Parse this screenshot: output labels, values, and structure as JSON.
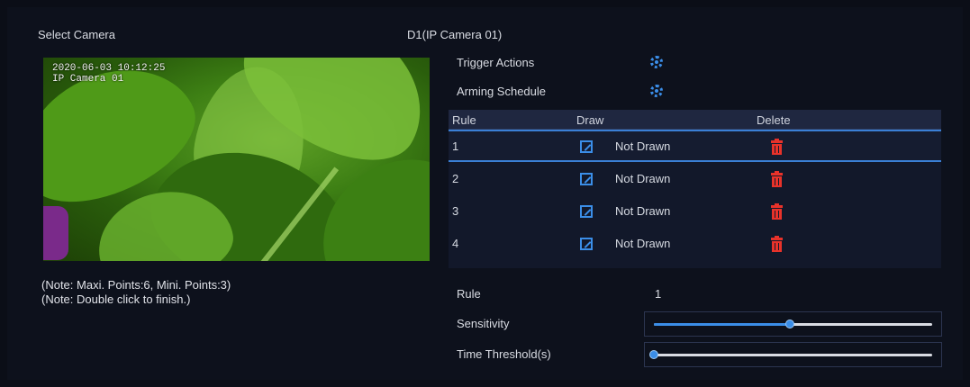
{
  "select_camera_label": "Select Camera",
  "camera_name": "D1(IP Camera 01)",
  "video": {
    "osd_datetime": "2020-06-03 10:12:25",
    "osd_name": "IP Camera 01"
  },
  "notes": [
    "(Note: Maxi. Points:6, Mini. Points:3)",
    "(Note: Double click to finish.)"
  ],
  "trigger_actions_label": "Trigger Actions",
  "arming_schedule_label": "Arming Schedule",
  "table": {
    "columns": [
      "Rule",
      "Draw",
      "Delete"
    ],
    "rows": [
      {
        "rule": "1",
        "status": "Not Drawn"
      },
      {
        "rule": "2",
        "status": "Not Drawn"
      },
      {
        "rule": "3",
        "status": "Not Drawn"
      },
      {
        "rule": "4",
        "status": "Not Drawn"
      }
    ],
    "selected_row": 0
  },
  "form": {
    "rule_label": "Rule",
    "rule_value": "1",
    "sensitivity_label": "Sensitivity",
    "sensitivity_fraction": 0.49,
    "time_threshold_label": "Time Threshold(s)",
    "time_threshold_fraction": 0.0
  },
  "colors": {
    "accent": "#3b8ee8",
    "delete": "#e8322a",
    "background": "#0d111c"
  },
  "icons": {
    "trigger_actions": "gear-icon",
    "arming_schedule": "gear-icon",
    "draw": "edit-icon",
    "delete": "trash-icon"
  }
}
